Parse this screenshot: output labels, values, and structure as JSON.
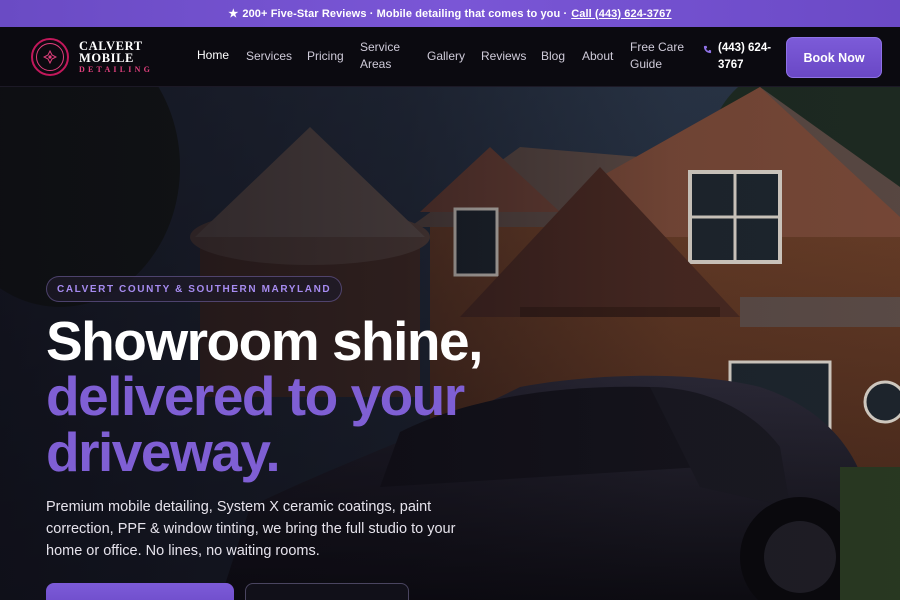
{
  "announcement": {
    "star": "★",
    "text": "200+ Five-Star Reviews · Mobile detailing that comes to you ·",
    "link": "Call (443) 624-3767"
  },
  "brand": {
    "line1": "CALVERT",
    "line2": "MOBILE",
    "line3": "DETAILING",
    "accent_color": "#e0407d"
  },
  "nav": {
    "home": "Home",
    "services": "Services",
    "pricing": "Pricing",
    "service_areas_1": "Service",
    "service_areas_2": "Areas",
    "gallery": "Gallery",
    "reviews": "Reviews",
    "blog": "Blog",
    "about": "About",
    "free_care_1": "Free Care",
    "free_care_2": "Guide",
    "phone_1": "(443) 624-",
    "phone_2": "3767",
    "book": "Book Now"
  },
  "hero": {
    "eyebrow": "CALVERT COUNTY & SOUTHERN MARYLAND",
    "headline_1": "Showroom shine,",
    "headline_2": "delivered to your",
    "headline_3": "driveway.",
    "subtext": "Premium mobile detailing, System X ceramic coatings, paint correction, PPF & window tinting, we bring the full studio to your home or office. No lines, no waiting rooms.",
    "accent_color": "#7f5fd4"
  },
  "colors": {
    "primary": "#7c5bd8",
    "background": "#0b0a10"
  }
}
